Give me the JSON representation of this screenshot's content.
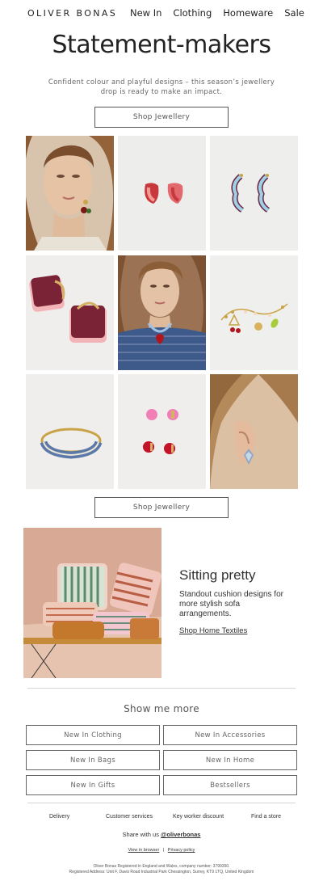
{
  "header": {
    "logo": "OLIVER BONAS",
    "nav": [
      "New In",
      "Clothing",
      "Homeware",
      "Sale"
    ]
  },
  "hero": {
    "title": "Statement-makers",
    "intro": "Confident colour and playful designs – this season’s jewellery drop is ready to make an impact.",
    "cta_top": "Shop Jewellery",
    "cta_bottom": "Shop Jewellery"
  },
  "products": [
    {
      "name": "model-wearing-cherry-earring"
    },
    {
      "name": "red-pink-enamel-hoop-earrings"
    },
    {
      "name": "blue-wavy-hoop-earrings"
    },
    {
      "name": "burgundy-pink-square-hoops"
    },
    {
      "name": "model-wearing-heart-necklace"
    },
    {
      "name": "charm-bracelet-cherries"
    },
    {
      "name": "blue-striped-cuff-bangle"
    },
    {
      "name": "pink-red-stud-earrings"
    },
    {
      "name": "model-wearing-crystal-earring"
    }
  ],
  "textiles": {
    "title": "Sitting pretty",
    "body": "Standout cushion designs for more stylish sofa arrangements.",
    "link": "Shop Home Textiles"
  },
  "more": {
    "title": "Show me more",
    "buttons": [
      "New In Clothing",
      "New In Accessories",
      "New In Bags",
      "New In Home",
      "New In Gifts",
      "Bestsellers"
    ]
  },
  "footer": {
    "links": [
      "Delivery",
      "Customer services",
      "Key worker discount",
      "Find a store"
    ],
    "share_prefix": "Share with us ",
    "share_handle": "@oliverbonas",
    "view_in_browser": "View in browser",
    "separator": "|",
    "privacy": "Privacy policy",
    "legal_line1": "Oliver Bonas Registered in England and Wales, company number: 3799350.",
    "legal_line2": "Registered Address: Unit F, Davis Road Industrial Park Chessington, Surrey, KT9 1TQ, United Kingdom"
  }
}
